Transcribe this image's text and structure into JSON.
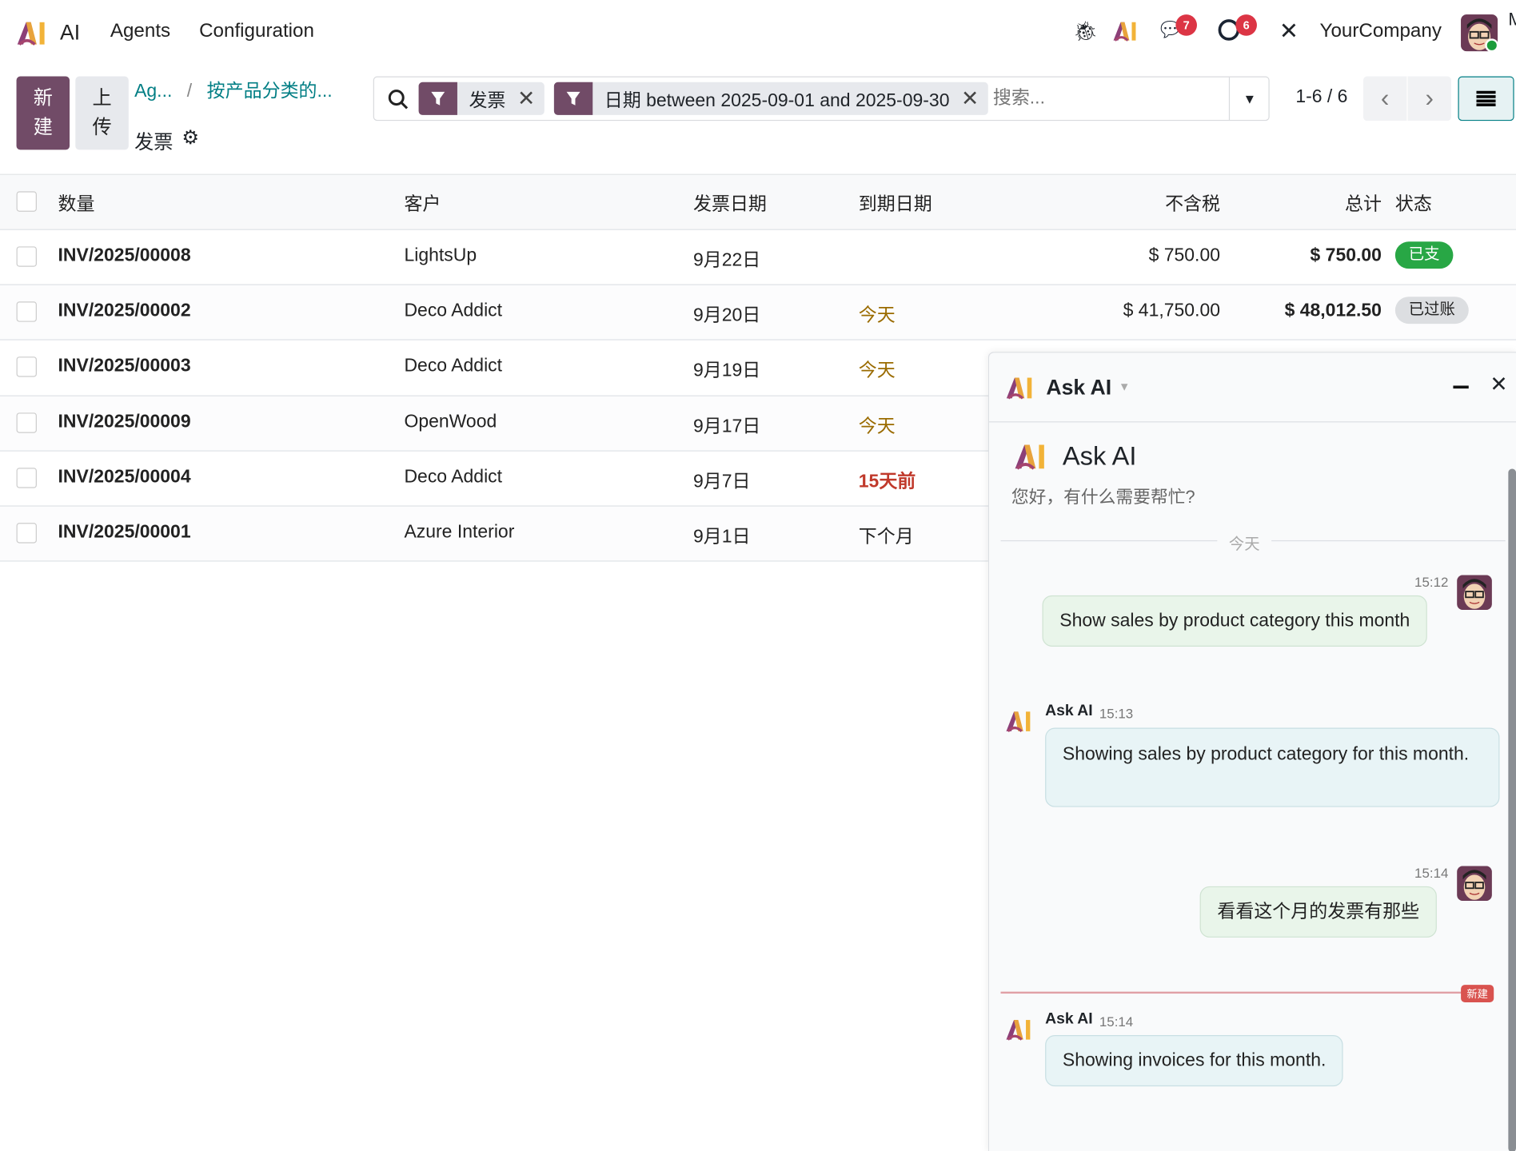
{
  "navbar": {
    "app_name": "AI",
    "menu": [
      "Agents",
      "Configuration"
    ],
    "chat_badge": "7",
    "activity_badge": "6",
    "company": "YourCompany",
    "user_initial": "M"
  },
  "control_panel": {
    "new_label": [
      "新",
      "建"
    ],
    "upload_label": [
      "上",
      "传"
    ],
    "breadcrumb": [
      "Ag...",
      "/",
      "按产品分类的..."
    ],
    "page_title": "发票",
    "search": {
      "facets": [
        "发票",
        "日期 between 2025-09-01 and 2025-09-30"
      ],
      "placeholder": "搜索..."
    },
    "pager": "1-6 / 6"
  },
  "table": {
    "headers": [
      "数量",
      "客户",
      "发票日期",
      "到期日期",
      "不含税",
      "总计",
      "状态"
    ],
    "rows": [
      {
        "number": "INV/2025/00008",
        "customer": "LightsUp",
        "date": "9月22日",
        "due": "",
        "untaxed": "$ 750.00",
        "total": "$ 750.00",
        "status": "已支"
      },
      {
        "number": "INV/2025/00002",
        "customer": "Deco Addict",
        "date": "9月20日",
        "due": "今天",
        "untaxed": "$ 41,750.00",
        "total": "$ 48,012.50",
        "status": "已过账"
      },
      {
        "number": "INV/2025/00003",
        "customer": "Deco Addict",
        "date": "9月19日",
        "due": "今天"
      },
      {
        "number": "INV/2025/00009",
        "customer": "OpenWood",
        "date": "9月17日",
        "due": "今天"
      },
      {
        "number": "INV/2025/00004",
        "customer": "Deco Addict",
        "date": "9月7日",
        "due": "15天前"
      },
      {
        "number": "INV/2025/00001",
        "customer": "Azure Interior",
        "date": "9月1日",
        "due": "下个月"
      }
    ]
  },
  "chat": {
    "title": "Ask AI",
    "intro_title": "Ask AI",
    "intro_text": "您好，有什么需要帮忙?",
    "date_sep": "今天",
    "new_sep": "新建",
    "messages": [
      {
        "author": "",
        "time": "15:12",
        "text": "Show sales by product category this month"
      },
      {
        "author": "Ask AI",
        "time": "15:13",
        "text": "Showing sales by product category for this month."
      },
      {
        "author": "",
        "time": "15:14",
        "text": "看看这个月的发票有那些"
      },
      {
        "author": "Ask AI",
        "time": "15:14",
        "text": "Showing invoices for this month."
      }
    ]
  },
  "colors": {
    "brand": "#714b67",
    "link": "#017e84",
    "warning": "#9a6b00",
    "danger": "#c0392b",
    "paid": "#28a745"
  }
}
